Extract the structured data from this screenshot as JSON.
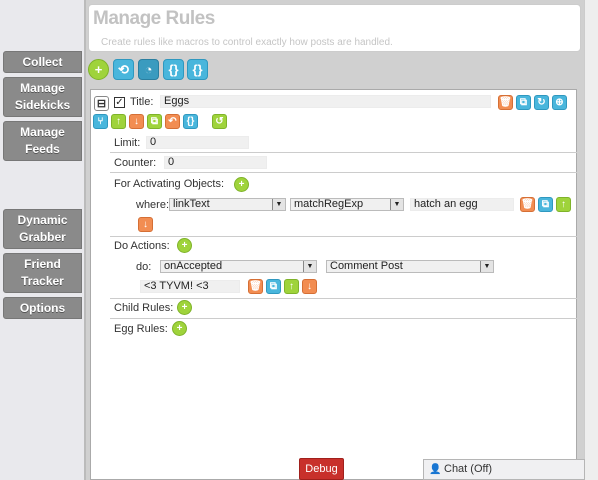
{
  "sidebar": {
    "collect": "Collect",
    "manage_sidekicks": [
      "Manage",
      "Sidekicks"
    ],
    "manage_feeds": [
      "Manage",
      "Feeds"
    ],
    "dynamic_grabber": [
      "Dynamic",
      "Grabber"
    ],
    "friend_tracker": [
      "Friend",
      "Tracker"
    ],
    "options": "Options"
  },
  "header": {
    "title": "Manage Rules",
    "subtitle": "Create rules like macros to control exactly how posts are handled."
  },
  "toolbar_icons": [
    "add-icon",
    "import-icon",
    "gauge-icon",
    "braces-icon",
    "braces-icon"
  ],
  "rule": {
    "collapse_symbol": "⊟",
    "checked": true,
    "title_label": "Title:",
    "title_value": "Eggs",
    "limit_label": "Limit:",
    "limit_value": "0",
    "counter_label": "Counter:",
    "counter_value": "0",
    "activating_label": "For Activating Objects:",
    "where_label": "where:",
    "where_field": "linkText",
    "where_op": "matchRegExp",
    "where_value": "hatch an egg",
    "actions_label": "Do Actions:",
    "do_label": "do:",
    "do_event": "onAccepted",
    "do_action": "Comment Post",
    "do_text": "<3 TYVM! <3",
    "child_rules_label": "Child Rules:",
    "egg_rules_label": "Egg Rules:"
  },
  "footer": {
    "debug_label": "Debug",
    "chat_label": "Chat (Off)"
  },
  "colors": {
    "green": "#9fd33b",
    "blue": "#49b6dc",
    "orange": "#f28d52",
    "debug_red": "#c8302b",
    "nav_gray": "#8a8a8a"
  }
}
